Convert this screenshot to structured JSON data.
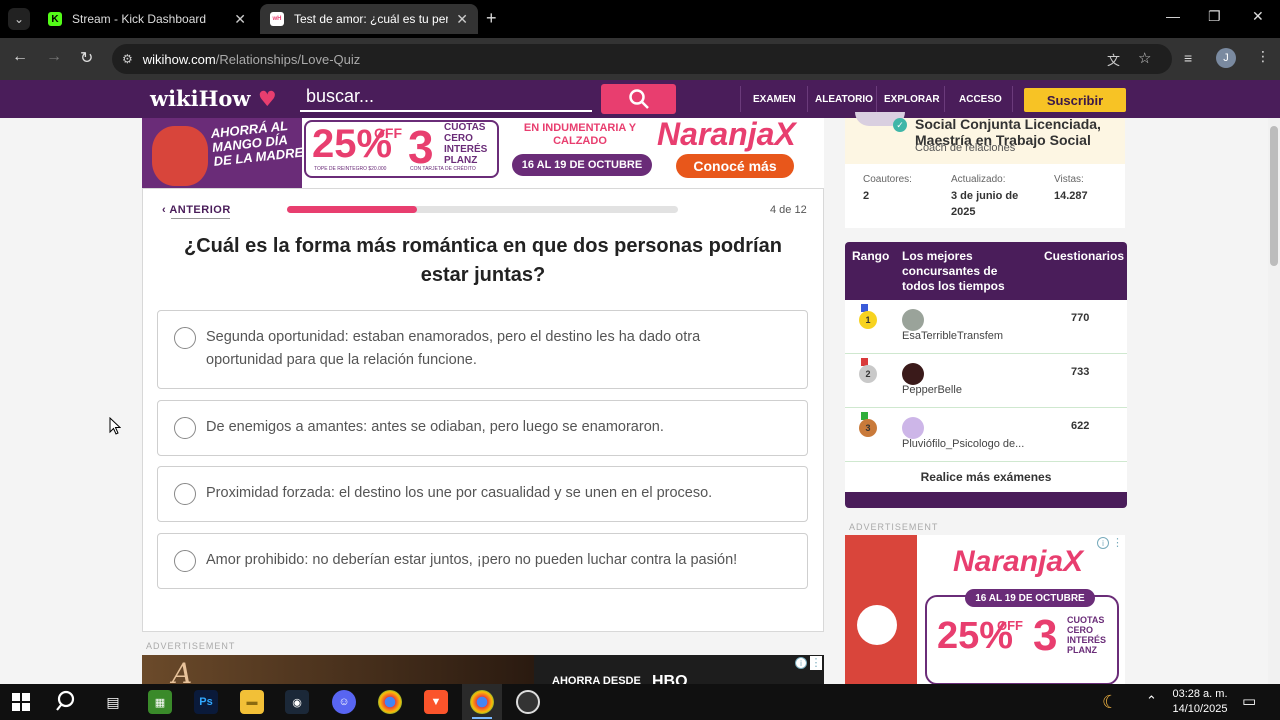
{
  "browser": {
    "tabs": [
      {
        "title": "Stream - Kick Dashboard",
        "active": false
      },
      {
        "title": "Test de amor: ¿cuál es tu persona",
        "active": true
      }
    ],
    "url_host": "wikihow.com",
    "url_path": "/Relationships/Love-Quiz"
  },
  "header": {
    "logo": "wikiHow",
    "search_placeholder": "buscar...",
    "nav": [
      "EXAMEN",
      "ALEATORIO",
      "EXPLORAR",
      "ACCESO"
    ],
    "subscribe": "Suscribir"
  },
  "top_ad": {
    "mascot_text": "AHORRÁ AL MANGO DÍA DE LA MADRE",
    "percent": "25%",
    "off": "OFF",
    "three": "3",
    "cuotas": "CUOTAS CERO INTERÉS PLANZ",
    "fine1": "TOPE DE REINTEGRO $20.000",
    "fine2": "CON TARJETA DE CRÉDITO",
    "category": "EN INDUMENTARIA Y CALZADO",
    "dates": "16 AL 19 DE OCTUBRE",
    "brand": "NaranjaX",
    "cta": "Conocé más"
  },
  "quiz": {
    "prev_label": "ANTERIOR",
    "progress_fraction": 0.333,
    "counter": "4 de 12",
    "question": "¿Cuál es la forma más romántica en que dos personas podrían estar juntas?",
    "options": [
      "Segunda oportunidad: estaban enamorados, pero el destino les ha dado otra oportunidad para que la relación funcione.",
      "De enemigos a amantes: antes se odiaban, pero luego se enamoraron.",
      "Proximidad forzada: el destino los une por casualidad y se unen en el proceso.",
      "Amor prohibido: no deberían estar juntos, ¡pero no pueden luchar contra la pasión!"
    ]
  },
  "ad_label": "ADVERTISEMENT",
  "bottom_ad": {
    "ahora": "AHORRA DESDE",
    "hbo": "HBO"
  },
  "expert": {
    "name_line1": "Social Conjunta Licenciada,",
    "name_line2": "Maestría en Trabajo Social",
    "role": "Coach de relaciones"
  },
  "stats": [
    {
      "label": "Coautores:",
      "value": "2"
    },
    {
      "label": "Actualizado:",
      "value": "3 de junio de 2025"
    },
    {
      "label": "Vistas:",
      "value": "14.287"
    }
  ],
  "leaderboard": {
    "col_rank": "Rango",
    "col_name": "Los mejores concursantes de todos los tiempos",
    "col_quizzes": "Cuestionarios",
    "rows": [
      {
        "rank": "1",
        "name": "EsaTerribleTransfem",
        "score": "770"
      },
      {
        "rank": "2",
        "name": "PepperBelle",
        "score": "733"
      },
      {
        "rank": "3",
        "name": "Pluviófilo_Psicologo de...",
        "score": "622"
      }
    ],
    "more": "Realice más exámenes"
  },
  "side_ad": {
    "brand": "NaranjaX",
    "dates": "16 AL 19 DE OCTUBRE",
    "percent": "25%",
    "off": "OFF",
    "three": "3",
    "cuotas": "CUOTAS CERO INTERÉS PLANZ"
  },
  "taskbar": {
    "time": "03:28 a. m.",
    "date": "14/10/2025"
  }
}
